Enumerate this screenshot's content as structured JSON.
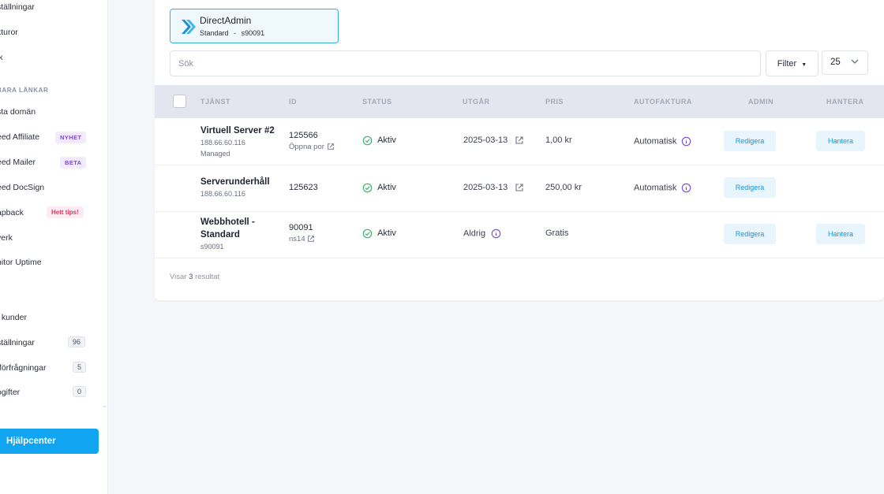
{
  "sidebar": {
    "items_top": [
      "ställningar",
      "kturor",
      "ik"
    ],
    "section_label": "BARA LÄNKAR",
    "links": [
      {
        "label": "sta domän"
      },
      {
        "label": "eed Affiliate",
        "badge": "NYHET"
      },
      {
        "label": "eed Mailer",
        "badge": "BETA"
      },
      {
        "label": "eed DocSign"
      },
      {
        "label": "apback",
        "badge": "Hett tips!"
      },
      {
        "label": "verk"
      },
      {
        "label": "nitor Uptime"
      }
    ],
    "bottom_items": [
      {
        "label": "t kunder"
      },
      {
        "label": "ställningar",
        "count": "96"
      },
      {
        "label": "tförfrågningar",
        "count": "5"
      },
      {
        "label": "ogifter",
        "count": "0"
      }
    ],
    "help_button": "Hjälpcenter"
  },
  "service_chip": {
    "title": "DirectAdmin",
    "plan": "Standard",
    "separator": "-",
    "account": "s90091"
  },
  "search": {
    "placeholder": "Sök"
  },
  "filter_label": "Filter",
  "per_page": "25",
  "table": {
    "headers": {
      "service": "TJÄNST",
      "id": "ID",
      "status": "STATUS",
      "expires": "UTGÅR",
      "price": "PRIS",
      "autoinvoice": "AUTOFAKTURA",
      "admin": "ADMIN",
      "manage": "HANTERA"
    },
    "rows": [
      {
        "name": "Virtuell Server #2",
        "sub1": "188.66.60.116",
        "sub2": "Managed",
        "id": "125566",
        "id_sub": "Öppna por",
        "status": "Aktiv",
        "expires": "2025-03-13",
        "price": "1,00 kr",
        "autoinvoice": "Automatisk",
        "admin_btn": "Redigera",
        "manage_btn": "Hantera"
      },
      {
        "name": "Serverunderhåll",
        "sub1": "188.66.60.116",
        "id": "125623",
        "status": "Aktiv",
        "expires": "2025-03-13",
        "price": "250,00 kr",
        "autoinvoice": "Automatisk",
        "admin_btn": "Redigera"
      },
      {
        "name_line1": "Webbhotell -",
        "name_line2": "Standard",
        "sub1": "s90091",
        "id": "90091",
        "id_sub": "ns14",
        "status": "Aktiv",
        "expires": "Aldrig",
        "price": "Gratis",
        "admin_btn": "Redigera",
        "manage_btn": "Hantera"
      }
    ]
  },
  "footer": {
    "prefix": "Visar",
    "count": "3",
    "suffix": "resultat"
  },
  "colors": {
    "accent": "#10a4f1",
    "status_ok": "#3cb371",
    "info": "#7c4bd6"
  }
}
